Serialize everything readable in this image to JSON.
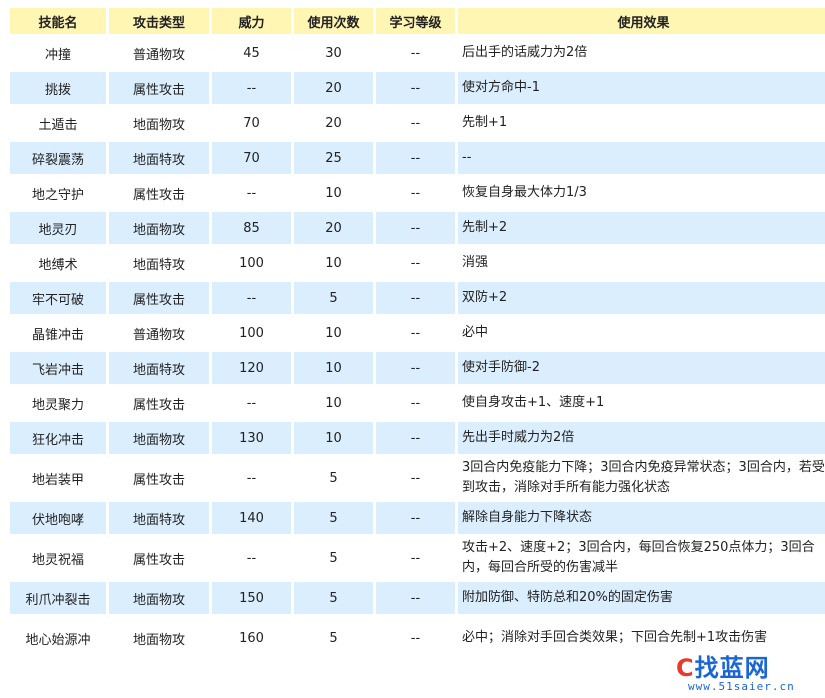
{
  "table": {
    "headers": [
      "技能名",
      "攻击类型",
      "威力",
      "使用次数",
      "学习等级",
      "使用效果"
    ],
    "rows": [
      {
        "name": "冲撞",
        "type": "普通物攻",
        "power": "45",
        "pp": "30",
        "level": "--",
        "effect": "后出手的话威力为2倍"
      },
      {
        "name": "挑拨",
        "type": "属性攻击",
        "power": "--",
        "pp": "20",
        "level": "--",
        "effect": "使对方命中-1"
      },
      {
        "name": "土遁击",
        "type": "地面物攻",
        "power": "70",
        "pp": "20",
        "level": "--",
        "effect": "先制+1"
      },
      {
        "name": "碎裂震荡",
        "type": "地面特攻",
        "power": "70",
        "pp": "25",
        "level": "--",
        "effect": "--"
      },
      {
        "name": "地之守护",
        "type": "属性攻击",
        "power": "--",
        "pp": "10",
        "level": "--",
        "effect": "恢复自身最大体力1/3"
      },
      {
        "name": "地灵刃",
        "type": "地面物攻",
        "power": "85",
        "pp": "20",
        "level": "--",
        "effect": "先制+2"
      },
      {
        "name": "地缚术",
        "type": "地面特攻",
        "power": "100",
        "pp": "10",
        "level": "--",
        "effect": "消强"
      },
      {
        "name": "牢不可破",
        "type": "属性攻击",
        "power": "--",
        "pp": "5",
        "level": "--",
        "effect": "双防+2"
      },
      {
        "name": "晶锥冲击",
        "type": "普通物攻",
        "power": "100",
        "pp": "10",
        "level": "--",
        "effect": "必中"
      },
      {
        "name": "飞岩冲击",
        "type": "地面特攻",
        "power": "120",
        "pp": "10",
        "level": "--",
        "effect": "使对手防御-2"
      },
      {
        "name": "地灵聚力",
        "type": "属性攻击",
        "power": "--",
        "pp": "10",
        "level": "--",
        "effect": "使自身攻击+1、速度+1"
      },
      {
        "name": "狂化冲击",
        "type": "地面物攻",
        "power": "130",
        "pp": "10",
        "level": "--",
        "effect": "先出手时威力为2倍"
      },
      {
        "name": "地岩装甲",
        "type": "属性攻击",
        "power": "--",
        "pp": "5",
        "level": "--",
        "effect": "3回合内免疫能力下降；3回合内免疫异常状态；3回合内，若受到攻击，消除对手所有能力强化状态"
      },
      {
        "name": "伏地咆哮",
        "type": "地面特攻",
        "power": "140",
        "pp": "5",
        "level": "--",
        "effect": "解除自身能力下降状态"
      },
      {
        "name": "地灵祝福",
        "type": "属性攻击",
        "power": "--",
        "pp": "5",
        "level": "--",
        "effect": "攻击+2、速度+2；3回合内，每回合恢复250点体力；3回合内，每回合所受的伤害减半"
      },
      {
        "name": "利爪冲裂击",
        "type": "地面物攻",
        "power": "150",
        "pp": "5",
        "level": "--",
        "effect": "附加防御、特防总和20%的固定伤害"
      },
      {
        "name": "地心始源冲",
        "type": "地面物攻",
        "power": "160",
        "pp": "5",
        "level": "--",
        "effect": "必中；消除对手回合类效果；下回合先制+1攻击伤害"
      }
    ]
  },
  "watermark": {
    "logo_part1": "C",
    "logo_part2": "找蓝网",
    "url": "www.51saier.cn"
  },
  "colors": {
    "header_bg": "#fff6b4",
    "row_alt_bg": "#dbeefd",
    "row_bg": "#ffffff"
  }
}
